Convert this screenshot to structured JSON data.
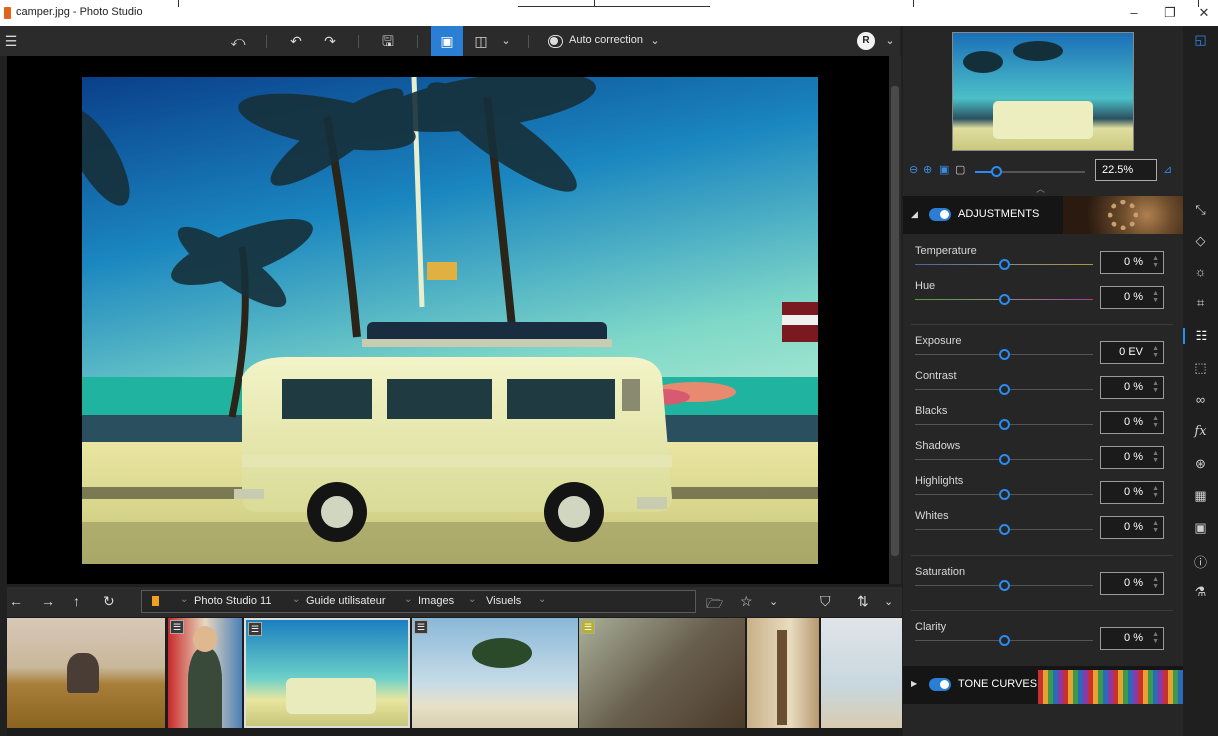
{
  "window": {
    "title": "camper.jpg - Photo Studio",
    "minimize": "–",
    "maximize": "❐",
    "close": "✕"
  },
  "toolbar": {
    "menu_icon": "☰",
    "rotate_icon": "⤺",
    "undo_icon": "↶",
    "redo_icon": "↷",
    "save_icon": "🖫",
    "single_view_icon": "▣",
    "compare_view_icon": "◫",
    "dropdown_icon": "⌄",
    "auto_correction_label": "Auto correction",
    "avatar_initial": "R"
  },
  "navbar": {
    "back_icon": "←",
    "forward_icon": "→",
    "up_icon": "↑",
    "refresh_icon": "↻",
    "breadcrumb": [
      "Photo Studio 11",
      "Guide utilisateur",
      "Images",
      "Visuels"
    ],
    "folder_icon": "🗁",
    "star_icon": "☆",
    "filter_icon": "⛉",
    "sort_icon": "⇅"
  },
  "filmstrip": {
    "items": [
      "elephant",
      "child",
      "camper",
      "beach-palms",
      "forest-path",
      "eiffel-tower",
      "seaside"
    ]
  },
  "panel": {
    "zoom_value": "22.5%",
    "adjustments_label": "ADJUSTMENTS",
    "tone_curves_label": "TONE CURVES",
    "adjustments": [
      {
        "name": "Temperature",
        "value": "0 %"
      },
      {
        "name": "Hue",
        "value": "0 %"
      },
      {
        "name": "Exposure",
        "value": "0 EV"
      },
      {
        "name": "Contrast",
        "value": "0 %"
      },
      {
        "name": "Blacks",
        "value": "0 %"
      },
      {
        "name": "Shadows",
        "value": "0 %"
      },
      {
        "name": "Highlights",
        "value": "0 %"
      },
      {
        "name": "Whites",
        "value": "0 %"
      },
      {
        "name": "Saturation",
        "value": "0 %"
      },
      {
        "name": "Clarity",
        "value": "0 %"
      }
    ]
  },
  "colors": {
    "accent": "#2a7fd4",
    "background": "#202020",
    "panel": "#262626"
  }
}
